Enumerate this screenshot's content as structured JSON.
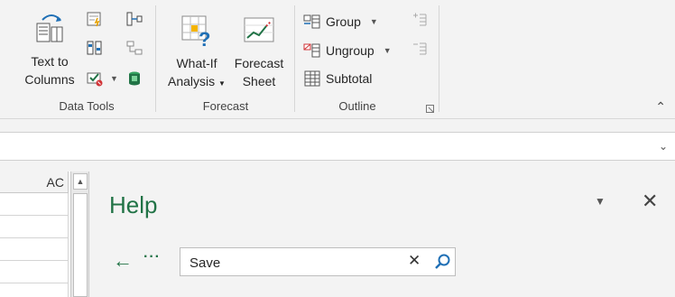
{
  "ribbon": {
    "data_tools": {
      "label": "Data Tools",
      "text_to_columns": {
        "line1": "Text to",
        "line2": "Columns"
      }
    },
    "forecast": {
      "label": "Forecast",
      "what_if": {
        "line1": "What-If",
        "line2": "Analysis"
      },
      "forecast_sheet": {
        "line1": "Forecast",
        "line2": "Sheet"
      }
    },
    "outline": {
      "label": "Outline",
      "group": "Group",
      "ungroup": "Ungroup",
      "subtotal": "Subtotal"
    }
  },
  "sheet": {
    "column_header": "AC"
  },
  "help": {
    "title": "Help",
    "search": {
      "value": "Save"
    }
  },
  "colors": {
    "accent": "#217346",
    "ribbon_bg": "#f3f3f3"
  }
}
